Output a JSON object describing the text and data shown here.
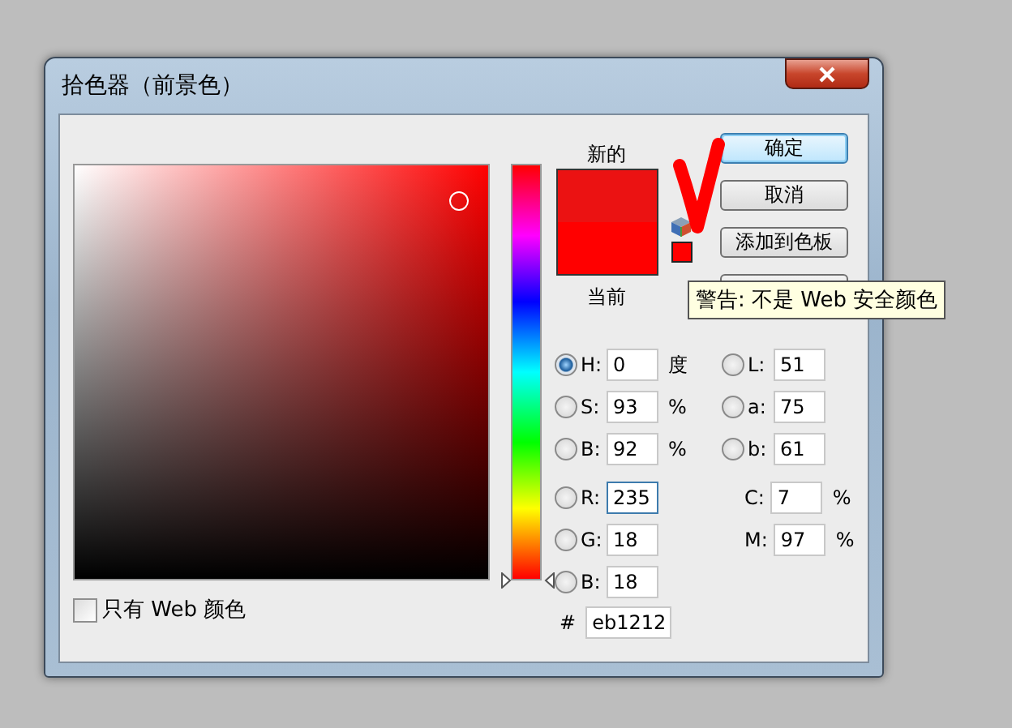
{
  "window": {
    "title": "拾色器（前景色）"
  },
  "hue_strip": {
    "level": 0
  },
  "swatches": [
    {
      "label": "新的",
      "color": "#eb1212"
    },
    {
      "label": "当前",
      "color": "#ff0000"
    }
  ],
  "web_safe_warning": {
    "color": "#ff0000",
    "tooltip": "警告: 不是 Web 安全颜色"
  },
  "buttons": [
    {
      "label": "确定",
      "default": true
    },
    {
      "label": "取消",
      "default": false
    },
    {
      "label": "添加到色板",
      "default": false
    }
  ],
  "fields_left": [
    {
      "kind": "radio",
      "label": "H:",
      "value": "0",
      "unit": "度",
      "selected": true,
      "focused": false
    },
    {
      "kind": "radio",
      "label": "S:",
      "value": "93",
      "unit": "%",
      "selected": false,
      "focused": false
    },
    {
      "kind": "radio",
      "label": "B:",
      "value": "92",
      "unit": "%",
      "selected": false,
      "focused": false
    },
    {
      "kind": "radio",
      "label": "R:",
      "value": "235",
      "selected": false,
      "focused": true
    },
    {
      "kind": "radio",
      "label": "G:",
      "value": "18",
      "selected": false,
      "focused": false
    },
    {
      "kind": "radio",
      "label": "B:",
      "value": "18",
      "selected": false,
      "focused": false
    }
  ],
  "fields_right": [
    {
      "kind": "radio",
      "label": "L:",
      "value": "51",
      "selected": false,
      "focused": false
    },
    {
      "kind": "radio",
      "label": "a:",
      "value": "75",
      "selected": false,
      "focused": false
    },
    {
      "kind": "radio",
      "label": "b:",
      "value": "61",
      "selected": false,
      "focused": false
    },
    {
      "kind": "plain",
      "label": "C:",
      "value": "7",
      "unit": "%",
      "focused": false
    },
    {
      "kind": "plain",
      "label": "M:",
      "value": "97",
      "unit": "%",
      "focused": false
    }
  ],
  "hex": {
    "label": "#",
    "value": "eb1212"
  },
  "web_only": {
    "label": "只有 Web 颜色",
    "checked": false
  }
}
